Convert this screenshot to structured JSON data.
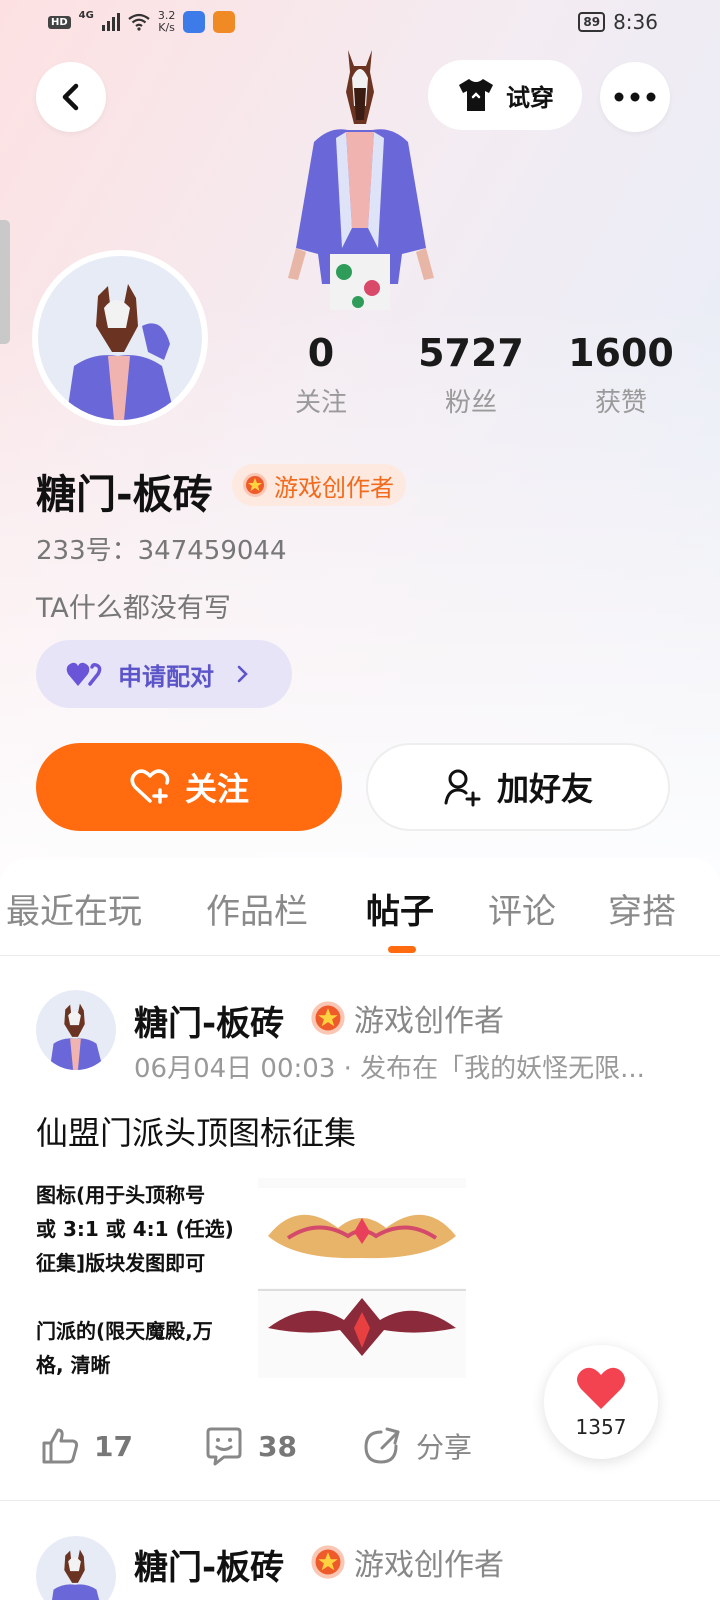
{
  "status_bar": {
    "badge": "HD",
    "network": "4G",
    "speed_value": "3.2",
    "speed_unit": "K/s",
    "battery": "89",
    "time": "8:36"
  },
  "header": {
    "tryon_label": "试穿"
  },
  "profile": {
    "stats": [
      {
        "value": "0",
        "label": "关注"
      },
      {
        "value": "5727",
        "label": "粉丝"
      },
      {
        "value": "1600",
        "label": "获赞"
      }
    ],
    "username": "糖门-板砖",
    "creator_tag": "游戏创作者",
    "uid": "233号：347459044",
    "bio": "TA什么都没有写",
    "pair_label": "申请配对",
    "follow_label": "关注",
    "add_friend_label": "加好友"
  },
  "tabs": [
    {
      "label": "最近在玩",
      "active": false
    },
    {
      "label": "作品栏",
      "active": false
    },
    {
      "label": "帖子",
      "active": true
    },
    {
      "label": "评论",
      "active": false
    },
    {
      "label": "穿搭",
      "active": false
    }
  ],
  "posts": [
    {
      "author": "糖门-板砖",
      "tag": "游戏创作者",
      "meta": "06月04日 00:03 · 发布在「我的妖怪无限...",
      "title": "仙盟门派头顶图标征集",
      "image_text": [
        "图标(用于头顶称号",
        "或 3:1 或 4:1 (任选)",
        "征集]版块发图即可",
        "",
        "门派的(限天魔殿,万",
        "格, 清晰"
      ],
      "likes": "17",
      "comments": "38",
      "share_label": "分享"
    },
    {
      "author": "糖门-板砖",
      "tag": "游戏创作者"
    }
  ],
  "floating_like": {
    "count": "1357"
  },
  "colors": {
    "accent": "#ff6b0e",
    "pair_purple": "#5b55c9",
    "tag_orange": "#f26b1d"
  }
}
